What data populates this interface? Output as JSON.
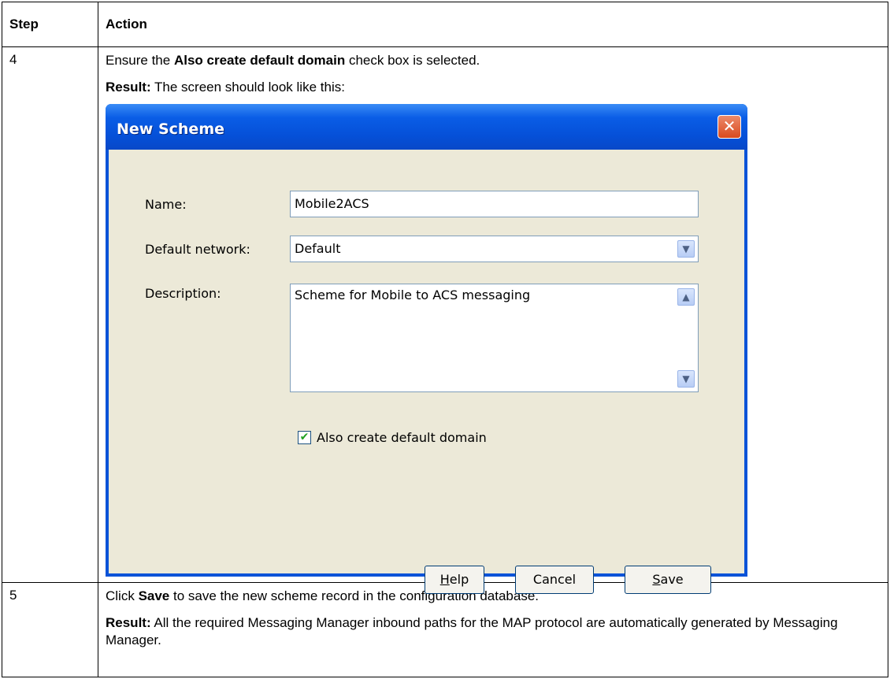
{
  "table": {
    "header_step": "Step",
    "header_action": "Action",
    "rows": [
      {
        "step": "4",
        "p1_pre": "Ensure the ",
        "p1_bold": "Also create default domain",
        "p1_post": " check box is selected.",
        "p2_bold": "Result:",
        "p2_text": " The screen should look like this:"
      },
      {
        "step": "5",
        "p1_pre": "Click ",
        "p1_bold": "Save",
        "p1_post": " to save the new scheme record in the configuration database.",
        "p2_bold": "Result:",
        "p2_text": " All the required Messaging Manager inbound paths for the MAP protocol are automatically generated by Messaging Manager."
      }
    ]
  },
  "dialog": {
    "title": "New Scheme",
    "close_glyph": "✕",
    "name_label": "Name:",
    "name_value": "Mobile2ACS",
    "network_label": "Default network:",
    "network_value": "Default",
    "description_label": "Description:",
    "description_value": "Scheme for Mobile to ACS messaging",
    "checkbox_label": "Also create default domain",
    "checkbox_checked": true,
    "help_first": "H",
    "help_rest": "elp",
    "cancel_label": "Cancel",
    "save_first": "S",
    "save_rest": "ave"
  },
  "colors": {
    "titlebar": "#0550d8",
    "client_bg": "#ece9d8",
    "close_button": "#d94a1f",
    "field_border": "#7f9db9"
  }
}
